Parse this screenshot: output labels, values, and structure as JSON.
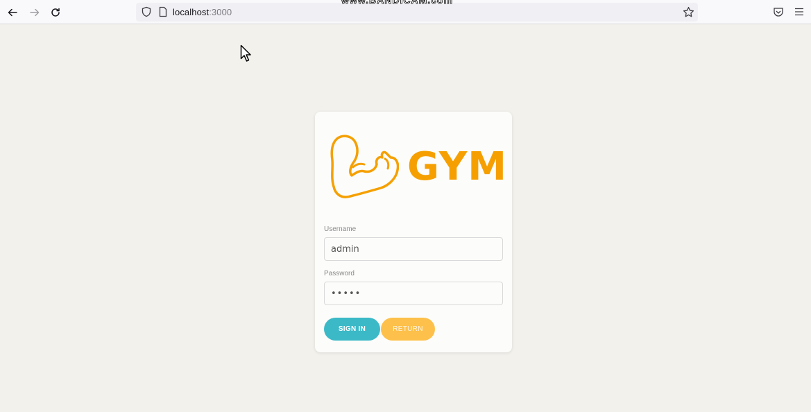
{
  "browser": {
    "url_host": "localhost",
    "url_port": ":3000",
    "watermark": "www.BANDICAM.com"
  },
  "login": {
    "logo_text": "GYM",
    "username_label": "Username",
    "username_value": "admin",
    "password_label": "Password",
    "password_value": "•••••",
    "signin_label": "SIGN IN",
    "return_label": "RETURN"
  },
  "colors": {
    "accent_orange": "#f5a000",
    "signin_teal": "#3bb9c7",
    "return_yellow": "#fdc04a",
    "background": "#f2f1ec"
  }
}
